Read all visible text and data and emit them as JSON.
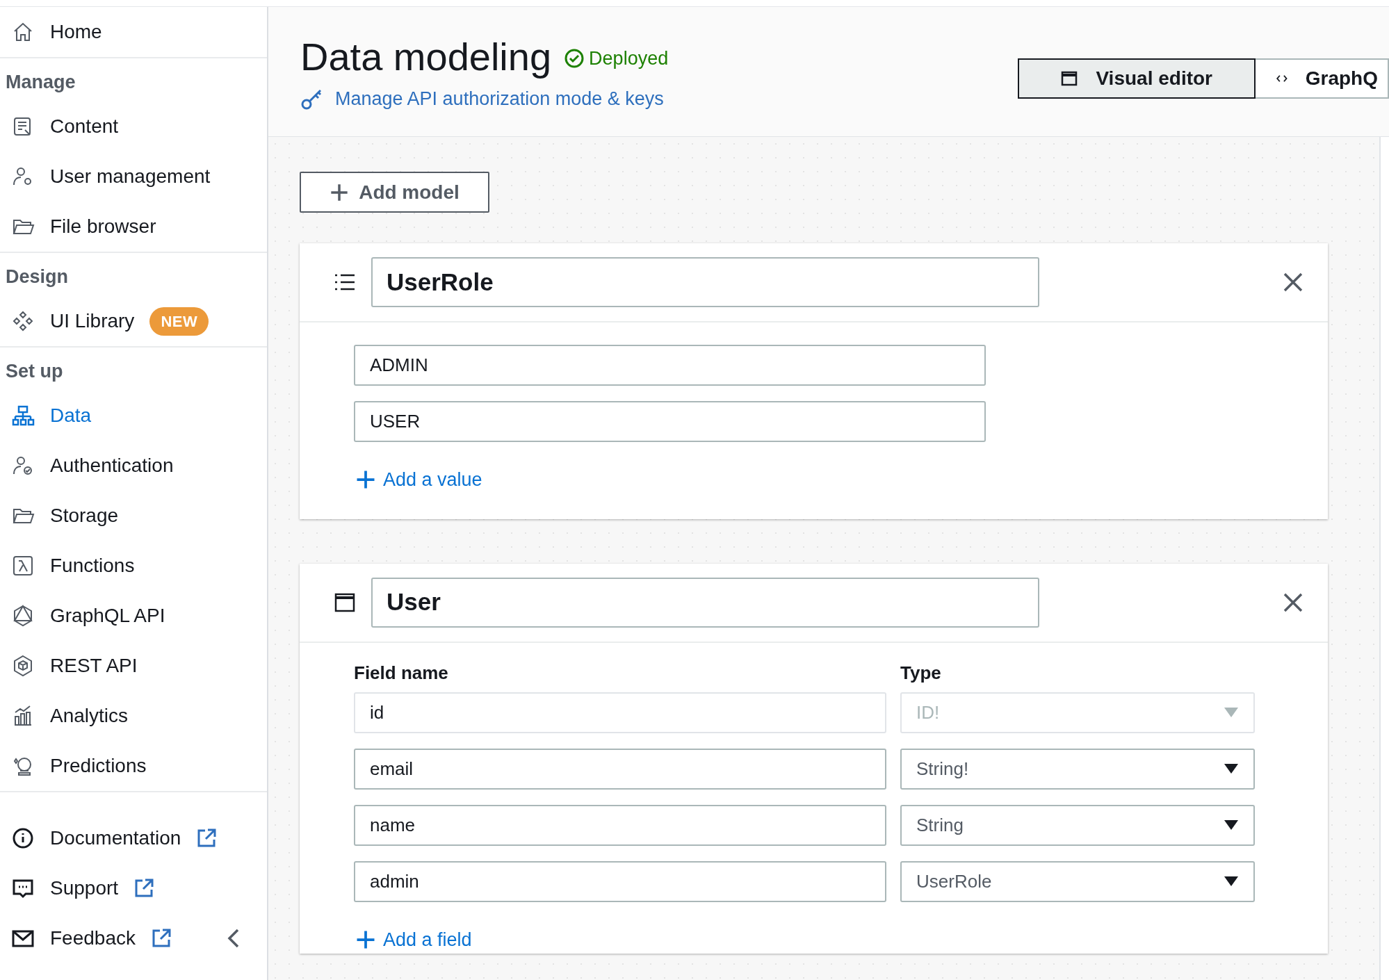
{
  "sidebar": {
    "home": {
      "label": "Home",
      "selected": false
    },
    "sections": [
      {
        "heading": "Manage",
        "items": [
          {
            "label": "Content",
            "selected": false
          },
          {
            "label": "User management",
            "selected": false
          },
          {
            "label": "File browser",
            "selected": false
          }
        ]
      },
      {
        "heading": "Design",
        "items": [
          {
            "label": "UI Library",
            "selected": false,
            "badge": "NEW"
          }
        ]
      },
      {
        "heading": "Set up",
        "items": [
          {
            "label": "Data",
            "selected": true
          },
          {
            "label": "Authentication",
            "selected": false
          },
          {
            "label": "Storage",
            "selected": false
          },
          {
            "label": "Functions",
            "selected": false
          },
          {
            "label": "GraphQL API",
            "selected": false
          },
          {
            "label": "REST API",
            "selected": false
          },
          {
            "label": "Analytics",
            "selected": false
          },
          {
            "label": "Predictions",
            "selected": false
          }
        ]
      }
    ],
    "links": [
      {
        "label": "Documentation"
      },
      {
        "label": "Support"
      },
      {
        "label": "Feedback"
      }
    ]
  },
  "header": {
    "title": "Data modeling",
    "status": "Deployed",
    "auth_link": "Manage API authorization mode & keys",
    "tabs": [
      {
        "label": "Visual editor",
        "selected": true
      },
      {
        "label": "GraphQ",
        "selected": false
      }
    ]
  },
  "add_model": "Add model",
  "models": [
    {
      "kind": "enum",
      "name": "UserRole",
      "values": [
        "ADMIN",
        "USER"
      ],
      "add_label": "Add a value"
    },
    {
      "kind": "model",
      "name": "User",
      "columns": [
        "Field name",
        "Type"
      ],
      "fields": [
        {
          "name": "id",
          "type": "ID!",
          "disabled": true
        },
        {
          "name": "email",
          "type": "String!",
          "disabled": false
        },
        {
          "name": "name",
          "type": "String",
          "disabled": false
        },
        {
          "name": "admin",
          "type": "UserRole",
          "disabled": false
        }
      ],
      "add_label": "Add a field"
    }
  ]
}
